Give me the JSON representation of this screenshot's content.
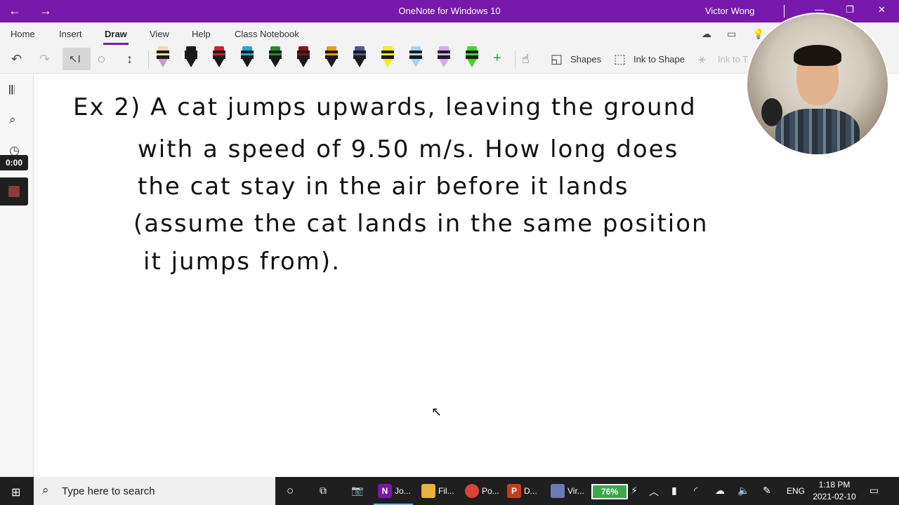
{
  "titlebar": {
    "app_title": "OneNote for Windows 10",
    "user": "Victor Wong",
    "accent": "#7719aa"
  },
  "ribbon": {
    "tabs": [
      {
        "label": "Home"
      },
      {
        "label": "Insert"
      },
      {
        "label": "Draw"
      },
      {
        "label": "View"
      },
      {
        "label": "Help"
      },
      {
        "label": "Class Notebook"
      }
    ],
    "active_tab": "Draw"
  },
  "toolbar": {
    "shapes_label": "Shapes",
    "ink_to_shape_label": "Ink to Shape",
    "ink_to_text_label": "Ink to T",
    "pens": [
      {
        "color": "#f2d7a0",
        "tip": "#c79ad6"
      },
      {
        "color": "#1a1a1a",
        "tip": "#1a1a1a"
      },
      {
        "color": "#d0202a",
        "tip": "#1a1a1a"
      },
      {
        "color": "#22a7d8",
        "tip": "#1a1a1a"
      },
      {
        "color": "#1e8f2c",
        "tip": "#1a1a1a"
      },
      {
        "color": "#8a1010",
        "tip": "#1a1a1a"
      },
      {
        "color": "#e8a000",
        "tip": "#1a1a1a"
      },
      {
        "color": "#555599",
        "tip": "#1a1a1a"
      },
      {
        "color": "#f5f000",
        "tip": "#f5f000"
      },
      {
        "color": "#9fd6f5",
        "tip": "#9fd6f5"
      },
      {
        "color": "#d7a6f2",
        "tip": "#d7a6f2"
      },
      {
        "color": "#3fd62a",
        "tip": "#3fd62a"
      }
    ]
  },
  "recorder": {
    "timer": "0:00"
  },
  "page": {
    "ink_lines": [
      "Ex 2)   A  cat  jumps  upwards,  leaving  the  ground",
      "with  a  speed  of  9.50 m/s.  How  long  does",
      "the  cat  stay  in  the  air  before  it  lands",
      "(assume  the  cat  lands  in  the  same  position",
      "it  jumps  from)."
    ]
  },
  "taskbar": {
    "search_placeholder": "Type here to search",
    "apps": [
      {
        "label": "Jo...",
        "icon": "onenote-icon",
        "color": "#7719aa",
        "glyph": "N"
      },
      {
        "label": "Fil...",
        "icon": "folder-icon",
        "color": "#e8b33a",
        "glyph": ""
      },
      {
        "label": "Po...",
        "icon": "chrome-icon",
        "color": "#db4437",
        "glyph": ""
      },
      {
        "label": "D...",
        "icon": "powerpoint-icon",
        "color": "#c43e1c",
        "glyph": "P"
      },
      {
        "label": "Vir...",
        "icon": "virtual-app-icon",
        "color": "#6a7ab8",
        "glyph": ""
      }
    ],
    "battery": "76%",
    "language": "ENG",
    "time": "1:18 PM",
    "date": "2021-02-10"
  }
}
